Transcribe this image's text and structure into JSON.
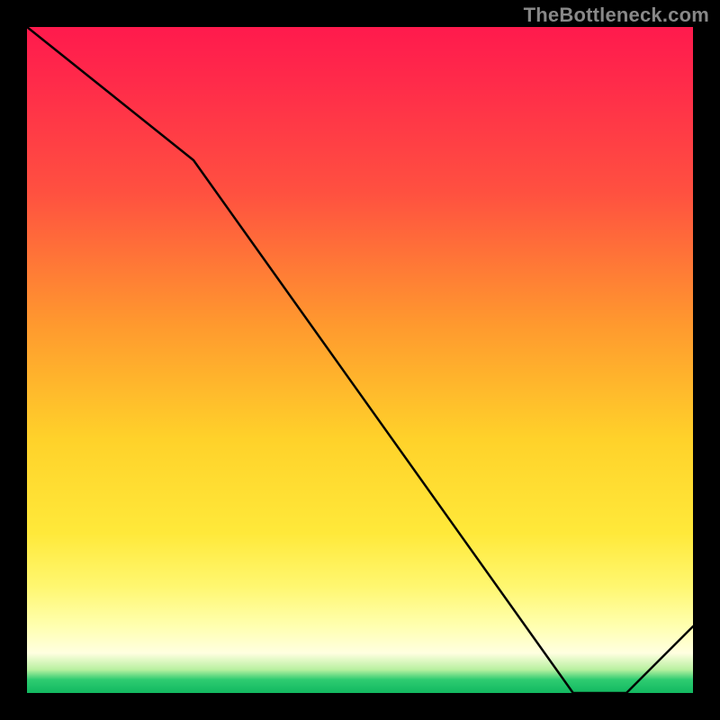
{
  "watermark": "TheBottleneck.com",
  "in_plot_label": "",
  "chart_data": {
    "type": "line",
    "title": "",
    "xlabel": "",
    "ylabel": "",
    "xlim": [
      0,
      100
    ],
    "ylim": [
      0,
      100
    ],
    "grid": false,
    "series": [
      {
        "name": "curve",
        "x": [
          0,
          25,
          82,
          90,
          100
        ],
        "y": [
          100,
          80,
          0,
          0,
          10
        ]
      }
    ],
    "background_gradient_stops": [
      {
        "pos": 0,
        "color": "#ff1a4d"
      },
      {
        "pos": 8,
        "color": "#ff2a4a"
      },
      {
        "pos": 25,
        "color": "#ff5140"
      },
      {
        "pos": 45,
        "color": "#ff9a2e"
      },
      {
        "pos": 62,
        "color": "#ffd22a"
      },
      {
        "pos": 76,
        "color": "#ffe93a"
      },
      {
        "pos": 84,
        "color": "#fff770"
      },
      {
        "pos": 90,
        "color": "#ffffb0"
      },
      {
        "pos": 94,
        "color": "#ffffe0"
      },
      {
        "pos": 96.5,
        "color": "#b8f0a0"
      },
      {
        "pos": 98,
        "color": "#2ecc71"
      },
      {
        "pos": 100,
        "color": "#12b860"
      }
    ]
  }
}
